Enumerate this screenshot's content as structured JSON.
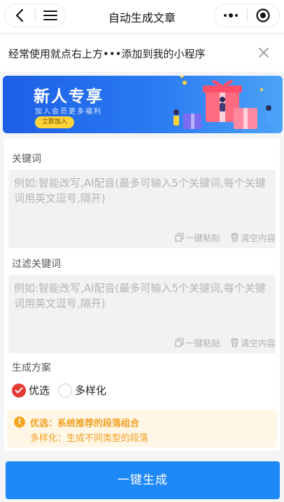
{
  "navbar": {
    "title": "自动生成文章",
    "back_icon": "chevron-left-icon",
    "menu_icon": "hamburger-icon",
    "more_icon": "more-dots-icon",
    "close_icon": "target-circle-icon"
  },
  "tip": {
    "text": "经常使用就点右上方•••添加到我的小程序",
    "close_icon": "close-icon"
  },
  "banner": {
    "title": "新人专享",
    "subtitle": "加入会员更多福利",
    "button": "立即加入"
  },
  "form": {
    "keywords": {
      "label": "关键词",
      "placeholder": "例如:智能改写,AI配音(最多可输入5个关键词,每个关键词用英文逗号,隔开)",
      "paste": "一键粘贴",
      "clear": "清空内容"
    },
    "filter": {
      "label": "过滤关键词",
      "placeholder": "例如:智能改写,AI配音(最多可输入5个关键词,每个关键词用英文逗号,隔开)",
      "paste": "一键粘贴",
      "clear": "清空内容"
    },
    "scheme": {
      "label": "生成方案",
      "options": [
        {
          "label": "优选",
          "selected": true
        },
        {
          "label": "多样化",
          "selected": false
        }
      ]
    },
    "notice": {
      "line1": "优选：系统推荐的段落组合",
      "line2": "多样化：生成不同类型的段落"
    }
  },
  "submit": {
    "label": "一键生成"
  },
  "colors": {
    "primary": "#1e88f6",
    "selected_radio": "#e53935",
    "notice_text": "#f0a020",
    "notice_bg": "#fff6e6"
  }
}
